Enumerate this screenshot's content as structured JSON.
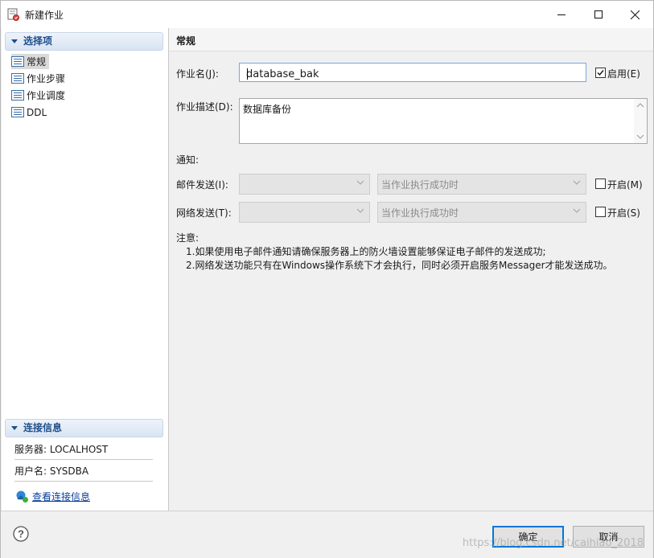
{
  "window": {
    "title": "新建作业"
  },
  "left": {
    "options_header": "选择项",
    "nav_items": [
      {
        "label": "常规",
        "selected": true
      },
      {
        "label": "作业步骤",
        "selected": false
      },
      {
        "label": "作业调度",
        "selected": false
      },
      {
        "label": "DDL",
        "selected": false
      }
    ],
    "conn_header": "连接信息",
    "server": "服务器: LOCALHOST",
    "user": "用户名: SYSDBA",
    "view_conn_link": "查看连接信息"
  },
  "general": {
    "header": "常规",
    "job_name_label": "作业名(J):",
    "job_name_value": "database_bak",
    "enable_label": "启用(E)",
    "enable_checked": true,
    "job_desc_label": "作业描述(D):",
    "job_desc_value": "数据库备份",
    "notify_label": "通知:",
    "mail_label": "邮件发送(I):",
    "mail_condition": "当作业执行成功时",
    "mail_enable_label": "开启(M)",
    "mail_enable_checked": false,
    "net_label": "网络发送(T):",
    "net_condition": "当作业执行成功时",
    "net_enable_label": "开启(S)",
    "net_enable_checked": false,
    "note_label": "注意:",
    "note_1": "1.如果使用电子邮件通知请确保服务器上的防火墙设置能够保证电子邮件的发送成功;",
    "note_2": "2.网络发送功能只有在Windows操作系统下才会执行，同时必须开启服务Messager才能发送成功。"
  },
  "footer": {
    "ok_label": "确定",
    "cancel_label": "取消",
    "watermark": "https://blog.csdn.net/caihiao_2018"
  },
  "colors": {
    "accent": "#0078d7",
    "section_header_text": "#1d4e8a",
    "link": "#0a3f9c"
  }
}
